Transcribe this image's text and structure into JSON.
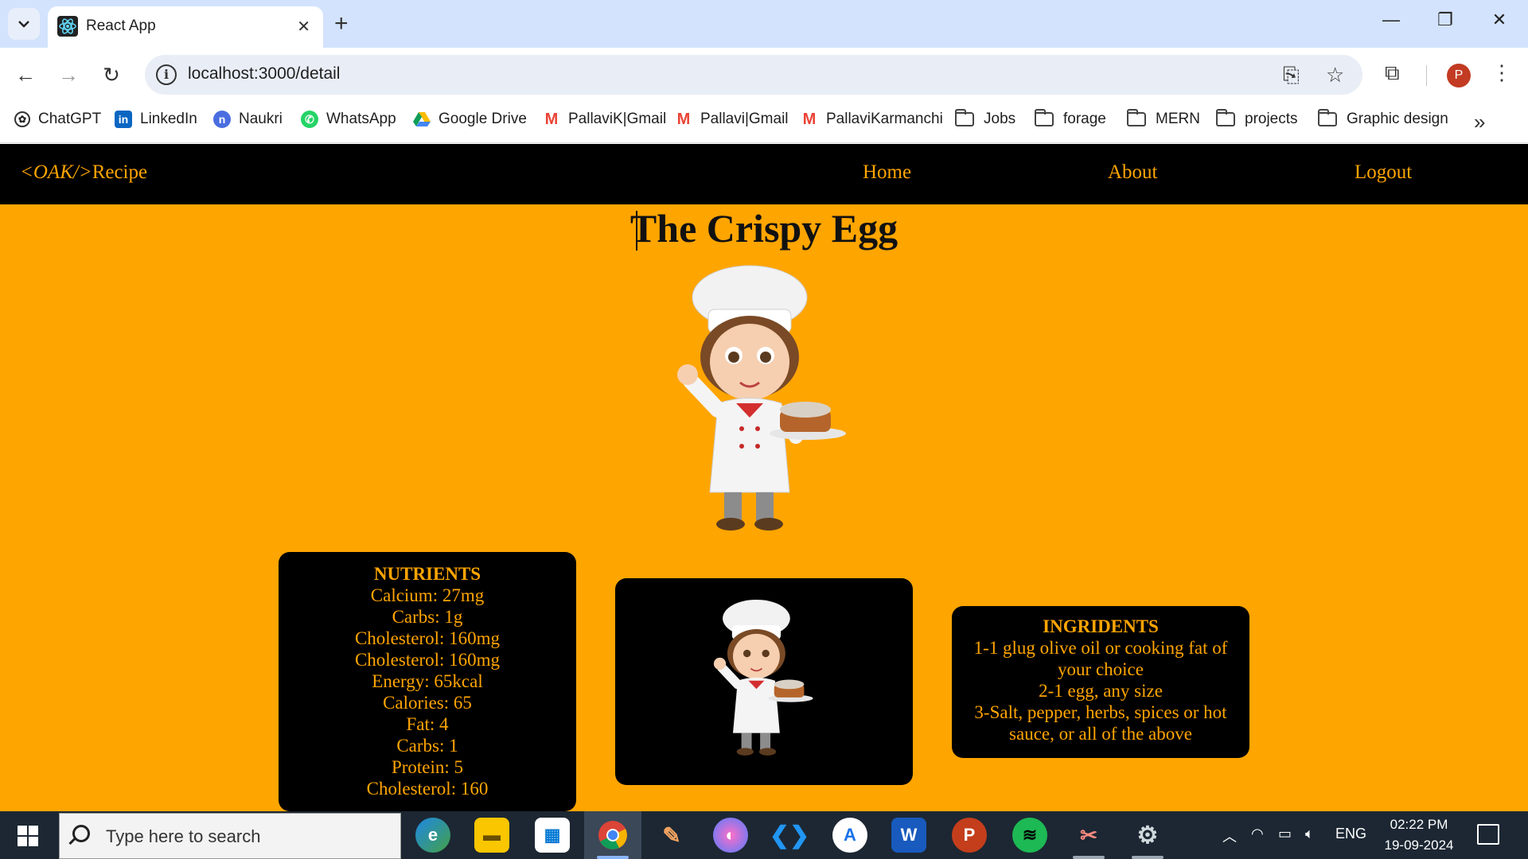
{
  "browser": {
    "tab_title": "React App",
    "url": "localhost:3000/detail",
    "profile_initial": "P",
    "bookmarks": [
      {
        "label": "ChatGPT",
        "icon": "chatgpt-icon"
      },
      {
        "label": "LinkedIn",
        "icon": "linkedin-icon"
      },
      {
        "label": "Naukri",
        "icon": "naukri-icon"
      },
      {
        "label": "WhatsApp",
        "icon": "whatsapp-icon"
      },
      {
        "label": "Google Drive",
        "icon": "google-drive-icon"
      },
      {
        "label": "PallaviK|Gmail",
        "icon": "gmail-icon"
      },
      {
        "label": "Pallavi|Gmail",
        "icon": "gmail-icon"
      },
      {
        "label": "PallaviKarmanchi",
        "icon": "gmail-icon"
      },
      {
        "label": "Jobs",
        "icon": "folder-icon"
      },
      {
        "label": "forage",
        "icon": "folder-icon"
      },
      {
        "label": "MERN",
        "icon": "folder-icon"
      },
      {
        "label": "projects",
        "icon": "folder-icon"
      },
      {
        "label": "Graphic design",
        "icon": "folder-icon"
      }
    ]
  },
  "navbar": {
    "brand_tag": "<OAK/>",
    "brand_text": "Recipe",
    "links": [
      "Home",
      "About",
      "Logout"
    ]
  },
  "recipe": {
    "title": "The Crispy Egg",
    "nutrients": {
      "heading": "NUTRIENTS",
      "items": [
        "Calcium: 27mg",
        "Carbs: 1g",
        "Cholesterol: 160mg",
        "Cholesterol: 160mg",
        "Energy: 65kcal",
        "Calories: 65",
        "Fat: 4",
        "Carbs: 1",
        "Protein: 5",
        "Cholesterol: 160"
      ]
    },
    "ingredients": {
      "heading": "INGRIDENTS",
      "items": [
        "1-1 glug olive oil or cooking fat of your choice",
        "2-1 egg, any size",
        "3-Salt, pepper, herbs, spices or hot sauce, or all of the above"
      ]
    }
  },
  "colors": {
    "page_background": "#ffa500",
    "navbar_background": "#000000",
    "accent_text": "#ffa500"
  },
  "taskbar": {
    "search_placeholder": "Type here to search",
    "language": "ENG",
    "time": "02:22 PM",
    "date": "19-09-2024"
  }
}
